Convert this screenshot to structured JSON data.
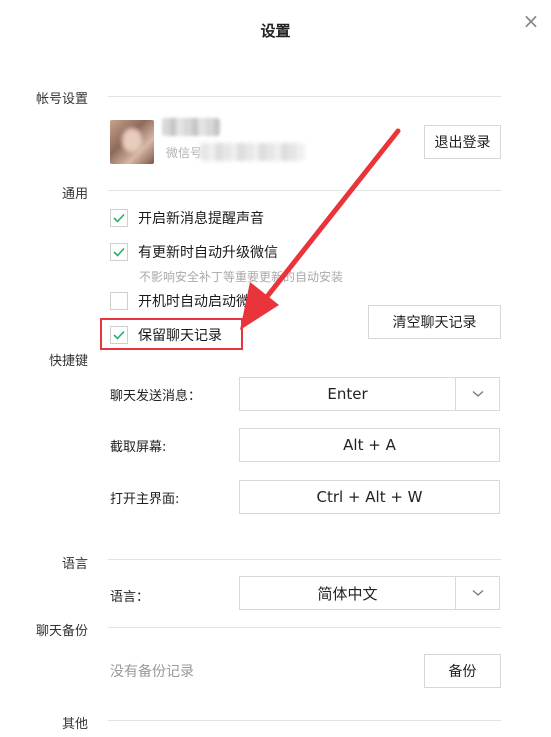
{
  "window": {
    "title": "设置",
    "close_glyph": "×"
  },
  "account": {
    "section_label": "帐号设置",
    "wxid_prefix": "微信号",
    "logout_label": "退出登录"
  },
  "general": {
    "section_label": "通用",
    "options": [
      {
        "label": "开启新消息提醒声音",
        "checked": true
      },
      {
        "label": "有更新时自动升级微信",
        "checked": true
      },
      {
        "label": "开机时自动启动微信",
        "checked": false
      },
      {
        "label": "保留聊天记录",
        "checked": true
      }
    ],
    "update_hint": "不影响安全补丁等重要更新的自动安装",
    "clear_history_label": "清空聊天记录"
  },
  "shortcuts": {
    "section_label": "快捷键",
    "send_label": "聊天发送消息：",
    "send_value": "Enter",
    "screenshot_label": "截取屏幕:",
    "screenshot_value": "Alt + A",
    "open_main_label": "打开主界面:",
    "open_main_value": "Ctrl + Alt + W"
  },
  "language": {
    "section_label": "语言",
    "field_label": "语言：",
    "value": "简体中文"
  },
  "backup": {
    "section_label": "聊天备份",
    "empty_text": "没有备份记录",
    "backup_button": "备份"
  },
  "other": {
    "section_label": "其他"
  },
  "annotation": {
    "color": "#e8343a"
  }
}
